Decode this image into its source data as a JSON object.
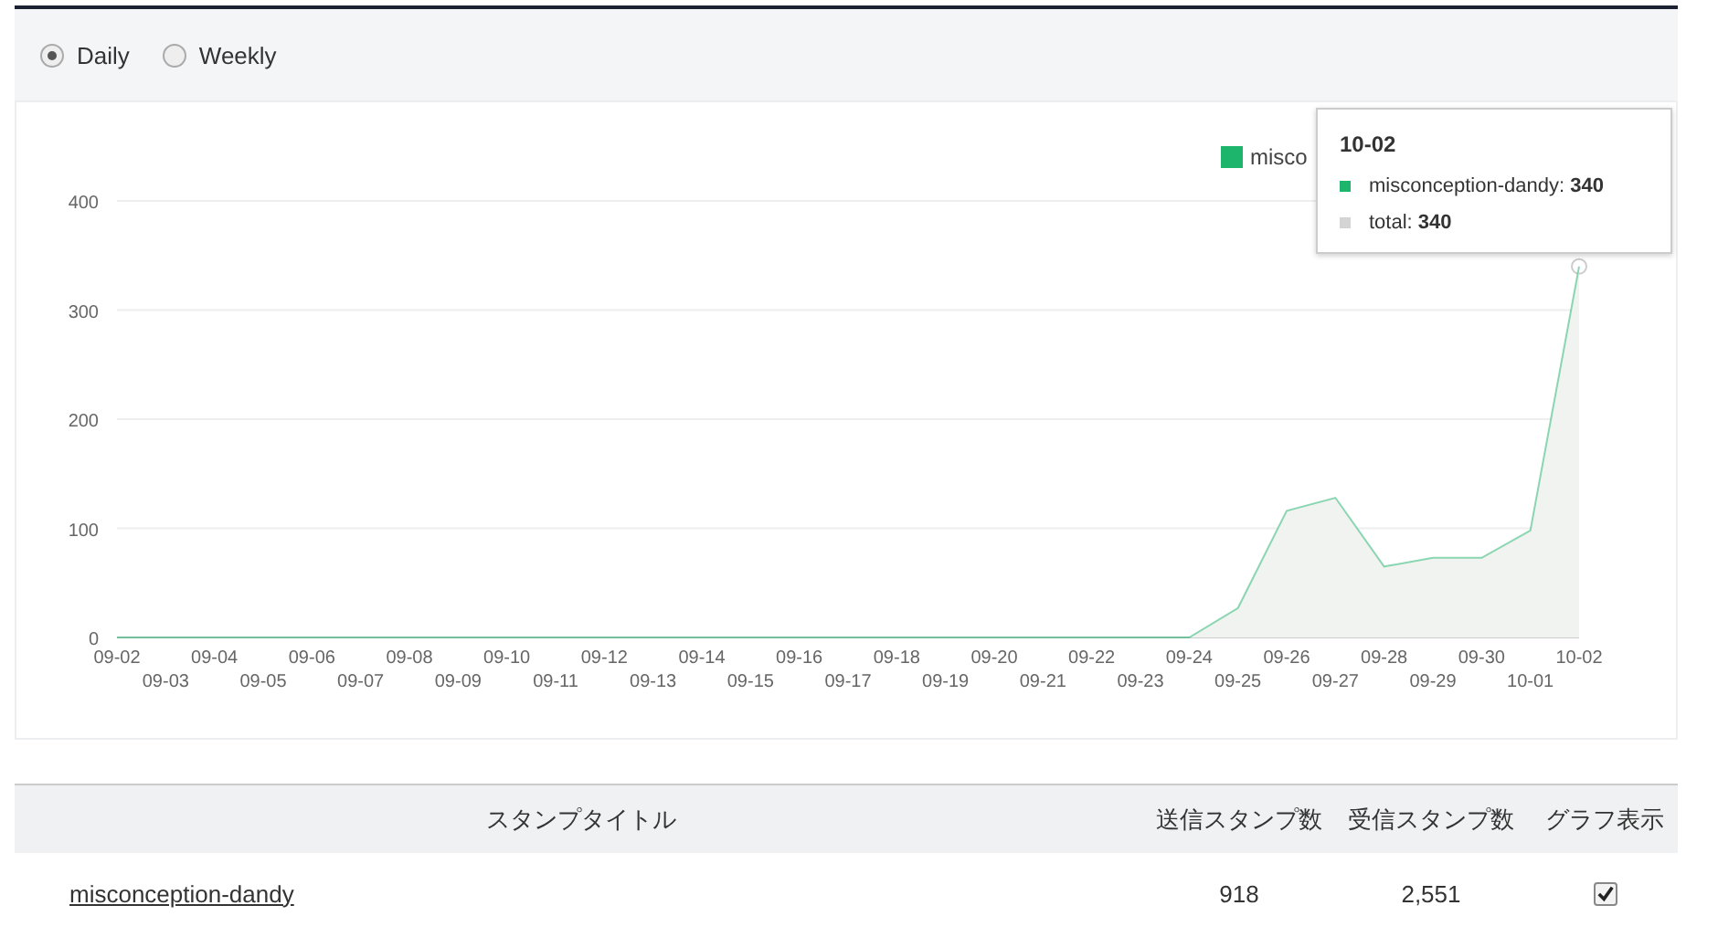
{
  "period_options": [
    {
      "label": "Daily",
      "selected": true
    },
    {
      "label": "Weekly",
      "selected": false
    }
  ],
  "chart": {
    "legend_label": "misco",
    "tooltip": {
      "title": "10-02",
      "separator": ":",
      "series_value": "340",
      "rows": [
        {
          "name": "total",
          "value": "340",
          "color": "#d4d4d4"
        }
      ]
    },
    "chart_data": {
      "type": "area",
      "grid": true,
      "categories": [
        "09-02",
        "09-03",
        "09-04",
        "09-05",
        "09-06",
        "09-07",
        "09-08",
        "09-09",
        "09-10",
        "09-11",
        "09-12",
        "09-13",
        "09-14",
        "09-15",
        "09-16",
        "09-17",
        "09-18",
        "09-19",
        "09-20",
        "09-21",
        "09-22",
        "09-23",
        "09-24",
        "09-25",
        "09-26",
        "09-27",
        "09-28",
        "09-29",
        "09-30",
        "10-01",
        "10-02"
      ],
      "series": [
        {
          "name": "misconception-dandy",
          "color": "#1db46c",
          "values": [
            0,
            0,
            0,
            0,
            0,
            0,
            0,
            0,
            0,
            0,
            0,
            0,
            0,
            0,
            0,
            0,
            0,
            0,
            0,
            0,
            0,
            0,
            0,
            27,
            116,
            128,
            65,
            73,
            73,
            98,
            340
          ]
        }
      ],
      "ylim": [
        0,
        400
      ],
      "yticks": [
        0,
        100,
        200,
        300,
        400
      ]
    }
  },
  "table": {
    "columns": [
      "スタンプタイトル",
      "送信スタンプ数",
      "受信スタンプ数",
      "グラフ表示"
    ],
    "rows": [
      {
        "title": "misconception-dandy",
        "sent": "918",
        "received": "2,551",
        "graph_shown": true
      }
    ]
  }
}
